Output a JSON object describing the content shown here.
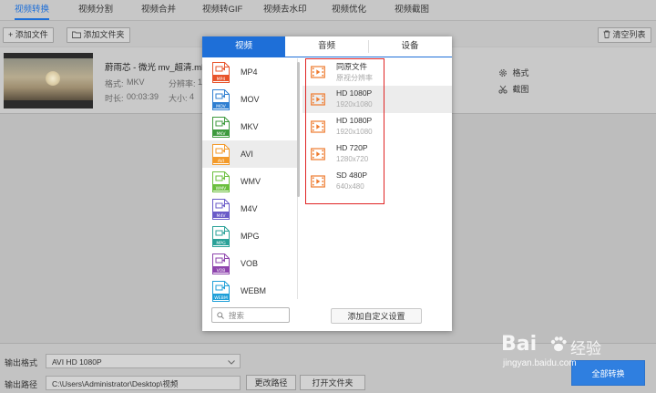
{
  "tabs": [
    "视频转换",
    "视频分割",
    "视频合并",
    "视频转GIF",
    "视频去水印",
    "视频优化",
    "视频截图"
  ],
  "toolbar": {
    "add_file": "添加文件",
    "add_folder": "添加文件夹",
    "clear_list": "清空列表"
  },
  "file": {
    "name": "蔚雨芯 - 微光 mv_超清.ml",
    "format_label": "格式:",
    "format_value": "MKV",
    "res_label": "分辨率:",
    "res_value": "1",
    "duration_label": "时长:",
    "duration_value": "00:03:39",
    "size_label": "大小:",
    "size_value": "4",
    "action_format": "格式",
    "action_screenshot": "截图"
  },
  "popup": {
    "tabs": [
      "视频",
      "音频",
      "设备"
    ],
    "formats": [
      "MP4",
      "MOV",
      "MKV",
      "AVI",
      "WMV",
      "M4V",
      "MPG",
      "VOB",
      "WEBM"
    ],
    "format_colors": [
      "#e8542b",
      "#2f7fd1",
      "#3d9a3d",
      "#f39a2a",
      "#6bbf3d",
      "#6a5bc8",
      "#2aa198",
      "#8e44ad",
      "#1f9fd8"
    ],
    "selected_format": "AVI",
    "resolutions": [
      {
        "title": "同原文件",
        "sub": "原视分辨率"
      },
      {
        "title": "HD 1080P",
        "sub": "1920x1080"
      },
      {
        "title": "HD 1080P",
        "sub": "1920x1080"
      },
      {
        "title": "HD 720P",
        "sub": "1280x720"
      },
      {
        "title": "SD 480P",
        "sub": "640x480"
      }
    ],
    "search_placeholder": "搜索",
    "custom_button": "添加自定义设置"
  },
  "bottom": {
    "output_format_label": "输出格式",
    "output_format_value": "AVI  HD 1080P",
    "output_path_label": "输出路径",
    "output_path_value": "C:\\Users\\Administrator\\Desktop\\视频",
    "change_path": "更改路径",
    "open_folder": "打开文件夹",
    "convert_all": "全部转换"
  },
  "watermark": {
    "brand": "Bai",
    "brand2": "经验",
    "url": "jingyan.baidu.com"
  },
  "colors": {
    "accent": "#1e6fd8",
    "highlight_box": "#e02424",
    "icon_orange": "#ee7b2f"
  }
}
